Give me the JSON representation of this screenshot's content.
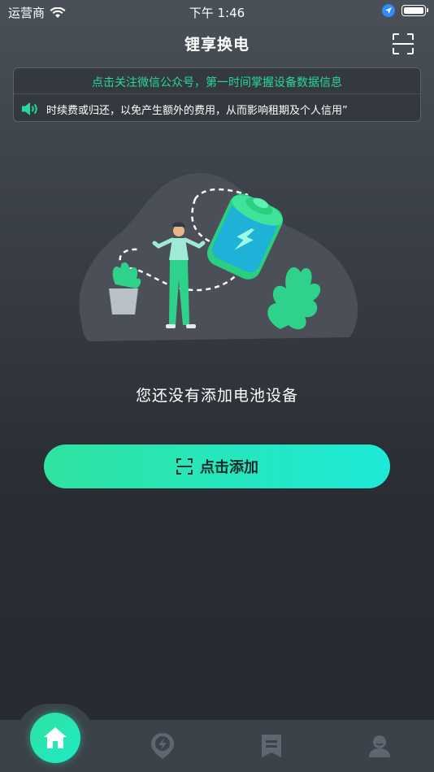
{
  "status_bar": {
    "carrier": "运营商",
    "time": "下午 1:46"
  },
  "nav": {
    "title": "锂享换电",
    "scan_icon": "scan-icon"
  },
  "notice": {
    "follow_text": "点击关注微信公众号，第一时间掌握设备数据信息",
    "marquee_text": "时续费或归还，以免产生额外的费用，从而影响租期及个人信用”",
    "accent_color": "#27d89a"
  },
  "main": {
    "empty_text": "您还没有添加电池设备",
    "add_button_label": "点击添加"
  },
  "tab_bar": {
    "items": [
      {
        "icon": "home-icon",
        "active": true
      },
      {
        "icon": "location-lightning-icon",
        "active": false
      },
      {
        "icon": "bookmark-list-icon",
        "active": false
      },
      {
        "icon": "user-icon",
        "active": false
      }
    ]
  },
  "colors": {
    "accent_start": "#2fe3a0",
    "accent_end": "#1de9d8",
    "background_top": "#4a5058",
    "background_bottom": "#26292f"
  }
}
